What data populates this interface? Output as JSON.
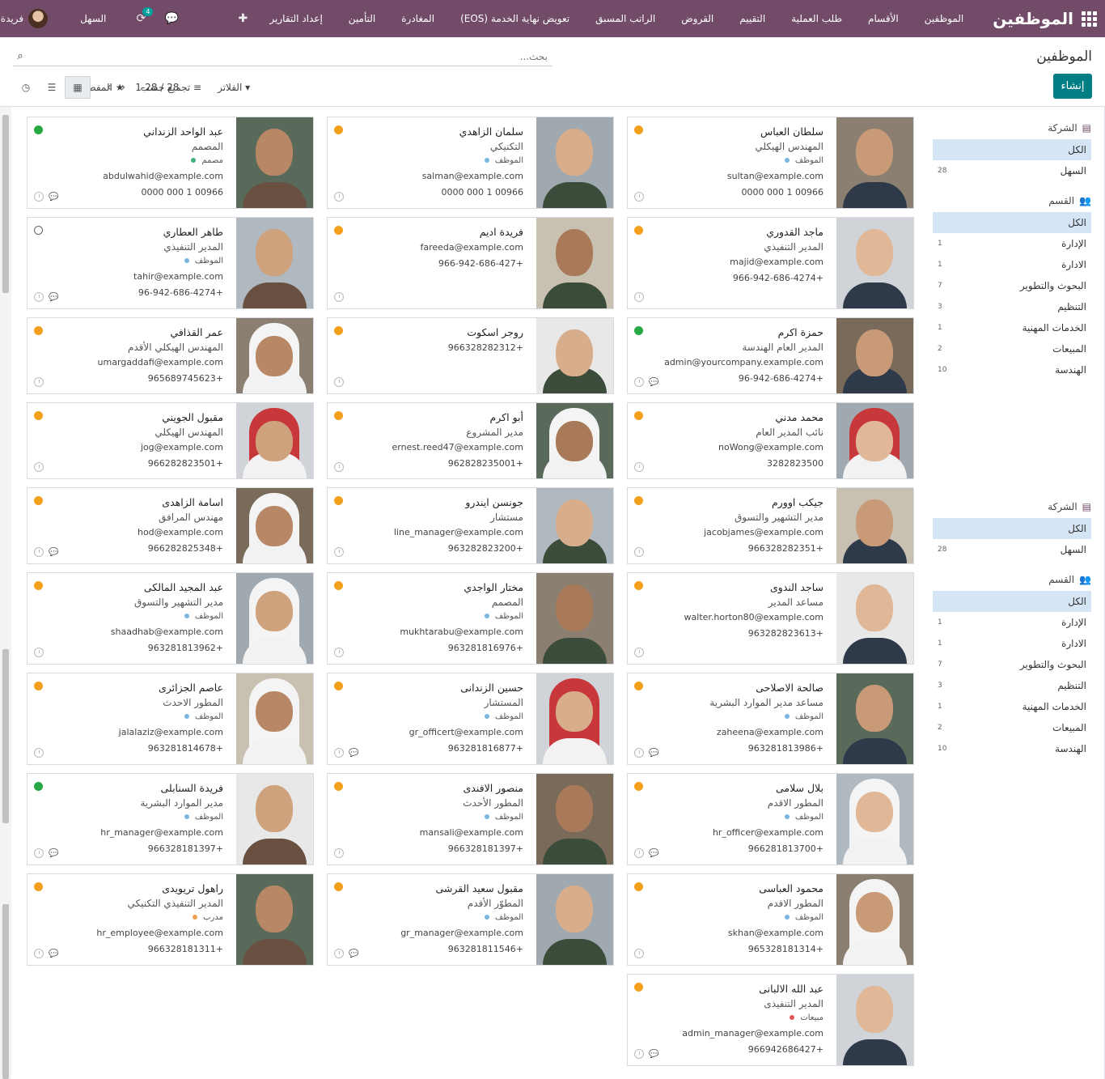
{
  "navbar": {
    "app_title": "الموظفين",
    "menu": [
      "الموظفين",
      "الأقسام",
      "طلب العملية",
      "التقييم",
      "القروض",
      "الراتب المسبق",
      "تعويض نهاية الخدمة (EOS)",
      "المغادرة",
      "التأمين",
      "إعداد التقارير"
    ],
    "activity_badge": "4",
    "company": "السهل",
    "user": "فريدة"
  },
  "control": {
    "breadcrumb": "الموظفين",
    "create_label": "إنشاء",
    "search_placeholder": "بحث...",
    "filters_label": "الفلاتر",
    "groupby_label": "تجميع حسب",
    "favorites_label": "المفضلات",
    "pager": "1-28 / 28"
  },
  "sidebar": {
    "company_title": "الشركة",
    "dept_title": "القسم",
    "all_label": "الكل",
    "companies": [
      {
        "name": "السهل",
        "count": "28"
      }
    ],
    "departments": [
      {
        "name": "الإدارة",
        "count": "1"
      },
      {
        "name": "الادارة",
        "count": "1"
      },
      {
        "name": "البحوث والتطوير",
        "count": "7"
      },
      {
        "name": "التنظيم",
        "count": "3"
      },
      {
        "name": "الخدمات المهنية",
        "count": "1"
      },
      {
        "name": "المبيعات",
        "count": "2"
      },
      {
        "name": "الهندسة",
        "count": "10"
      }
    ]
  },
  "employees": [
    {
      "name": "سلطان العباس",
      "job": "المهندس الهيكلي",
      "tag": "الموظف",
      "tag_color": "#7ab6e0",
      "email": "sultan@example.com",
      "phone": "00966 1 000 0000",
      "status": "orange",
      "chat": false
    },
    {
      "name": "سلمان الزاهدي",
      "job": "التكنيكي",
      "tag": "الموظف",
      "tag_color": "#7ab6e0",
      "email": "salman@example.com",
      "phone": "00966 1 000 0000",
      "status": "orange",
      "chat": false
    },
    {
      "name": "عبد الواحد الزنداني",
      "job": "المصمم",
      "tag": "مصمم",
      "tag_color": "#3cb07a",
      "email": "abdulwahid@example.com",
      "phone": "00966 1 000 0000",
      "status": "green",
      "chat": true
    },
    {
      "name": "ماجد القدوري",
      "job": "المدير التنفيذي",
      "tag": "",
      "tag_color": "",
      "email": "majid@example.com",
      "phone": "+966-942-686-4274",
      "status": "orange",
      "chat": false
    },
    {
      "name": "فريدة اديم",
      "job": "",
      "tag": "",
      "tag_color": "",
      "email": "fareeda@example.com",
      "phone": "+966-942-686-427",
      "status": "orange",
      "chat": false
    },
    {
      "name": "طاهر العطاري",
      "job": "المدير التنفيذي",
      "tag": "الموظف",
      "tag_color": "#7ab6e0",
      "email": "tahir@example.com",
      "phone": "+96-942-686-4274",
      "status": "none",
      "chat": true
    },
    {
      "name": "حمزة اكرم",
      "job": "المدير العام الهندسة",
      "tag": "",
      "tag_color": "",
      "email": "admin@yourcompany.example.com",
      "phone": "+96-942-686-4274",
      "status": "green",
      "chat": true
    },
    {
      "name": "روجر اسكوت",
      "job": "",
      "tag": "",
      "tag_color": "",
      "email": "",
      "phone": "+966328282312",
      "status": "orange",
      "chat": false
    },
    {
      "name": "عمر القذافي",
      "job": "المهندس الهيكلي الأقدم",
      "tag": "",
      "tag_color": "",
      "email": "umargaddafi@example.com",
      "phone": "+965689745623",
      "status": "orange",
      "chat": false
    },
    {
      "name": "محمد مدني",
      "job": "نائب المدير العام",
      "tag": "",
      "tag_color": "",
      "email": "noWong@example.com",
      "phone": "3282823500",
      "status": "orange",
      "chat": false
    },
    {
      "name": "أبو اكرم",
      "job": "مدير المشروع",
      "tag": "",
      "tag_color": "",
      "email": "ernest.reed47@example.com",
      "phone": "+962828235001",
      "status": "orange",
      "chat": false
    },
    {
      "name": "مقبول الجويني",
      "job": "المهندس الهيكلي",
      "tag": "",
      "tag_color": "",
      "email": "jog@example.com",
      "phone": "+966282823501",
      "status": "orange",
      "chat": false
    },
    {
      "name": "جيكب اوورم",
      "job": "مدير التشهير والتسوق",
      "tag": "",
      "tag_color": "",
      "email": "jacobjames@example.com",
      "phone": "+966328282351",
      "status": "orange",
      "chat": false
    },
    {
      "name": "جونسن ايندرو",
      "job": "مستشار",
      "tag": "",
      "tag_color": "",
      "email": "line_manager@example.com",
      "phone": "+963282823200",
      "status": "orange",
      "chat": false
    },
    {
      "name": "اسامة الزاهدى",
      "job": "مهندس المرافق",
      "tag": "",
      "tag_color": "",
      "email": "hod@example.com",
      "phone": "+966282825348",
      "status": "orange",
      "chat": true
    },
    {
      "name": "ساجد الندوى",
      "job": "مساعد المدير",
      "tag": "",
      "tag_color": "",
      "email": "walter.horton80@example.com",
      "phone": "+963282823613",
      "status": "orange",
      "chat": false
    },
    {
      "name": "مختار الواجدي",
      "job": "المصمم",
      "tag": "الموظف",
      "tag_color": "#7ab6e0",
      "email": "mukhtarabu@example.com",
      "phone": "+963281816976",
      "status": "orange",
      "chat": false
    },
    {
      "name": "عبد المجيد المالكى",
      "job": "مدير التشهير والتسوق",
      "tag": "الموظف",
      "tag_color": "#7ab6e0",
      "email": "shaadhab@example.com",
      "phone": "+963281813962",
      "status": "orange",
      "chat": false
    },
    {
      "name": "صالحة الاصلاحى",
      "job": "مساعد مدير الموارد البشرية",
      "tag": "الموظف",
      "tag_color": "#7ab6e0",
      "email": "zaheena@example.com",
      "phone": "+963281813986",
      "status": "orange",
      "chat": true
    },
    {
      "name": "حسين الزندانى",
      "job": "المستشار",
      "tag": "الموظف",
      "tag_color": "#7ab6e0",
      "email": "gr_officert@example.com",
      "phone": "+963281816877",
      "status": "orange",
      "chat": true
    },
    {
      "name": "عاصم الجزائرى",
      "job": "المطور الاحدث",
      "tag": "الموظف",
      "tag_color": "#7ab6e0",
      "email": "jalalaziz@example.com",
      "phone": "+963281814678",
      "status": "orange",
      "chat": false
    },
    {
      "name": "بلال سلامى",
      "job": "المطور الاقدم",
      "tag": "الموظف",
      "tag_color": "#7ab6e0",
      "email": "hr_officer@example.com",
      "phone": "+966281813700",
      "status": "orange",
      "chat": true
    },
    {
      "name": "منصور الافندى",
      "job": "المطور الأحدث",
      "tag": "الموظف",
      "tag_color": "#7ab6e0",
      "email": "mansali@example.com",
      "phone": "+966328181397",
      "status": "orange",
      "chat": false
    },
    {
      "name": "فريدة السنابلى",
      "job": "مدير الموارد البشرية",
      "tag": "الموظف",
      "tag_color": "#7ab6e0",
      "email": "hr_manager@example.com",
      "phone": "+966328181397",
      "status": "green",
      "chat": true
    },
    {
      "name": "محمود العباسى",
      "job": "المطور الاقدم",
      "tag": "الموظف",
      "tag_color": "#7ab6e0",
      "email": "skhan@example.com",
      "phone": "+965328181314",
      "status": "orange",
      "chat": false
    },
    {
      "name": "مقبول سعيد القرشى",
      "job": "المطوّر الأقدم",
      "tag": "الموظف",
      "tag_color": "#7ab6e0",
      "email": "gr_manager@example.com",
      "phone": "+963281811546",
      "status": "orange",
      "chat": true
    },
    {
      "name": "راهول تريويدى",
      "job": "المدير التنفيذي التكنيكي",
      "tag": "مدرب",
      "tag_color": "#f0a050",
      "email": "hr_employee@example.com",
      "phone": "+966328181311",
      "status": "orange",
      "chat": true
    },
    {
      "name": "عبد الله الالبانى",
      "job": "المدير التنفيذى",
      "tag": "مبيعات",
      "tag_color": "#e05858",
      "email": "admin_manager@example.com",
      "phone": "+966942686427",
      "status": "orange",
      "chat": true
    }
  ]
}
